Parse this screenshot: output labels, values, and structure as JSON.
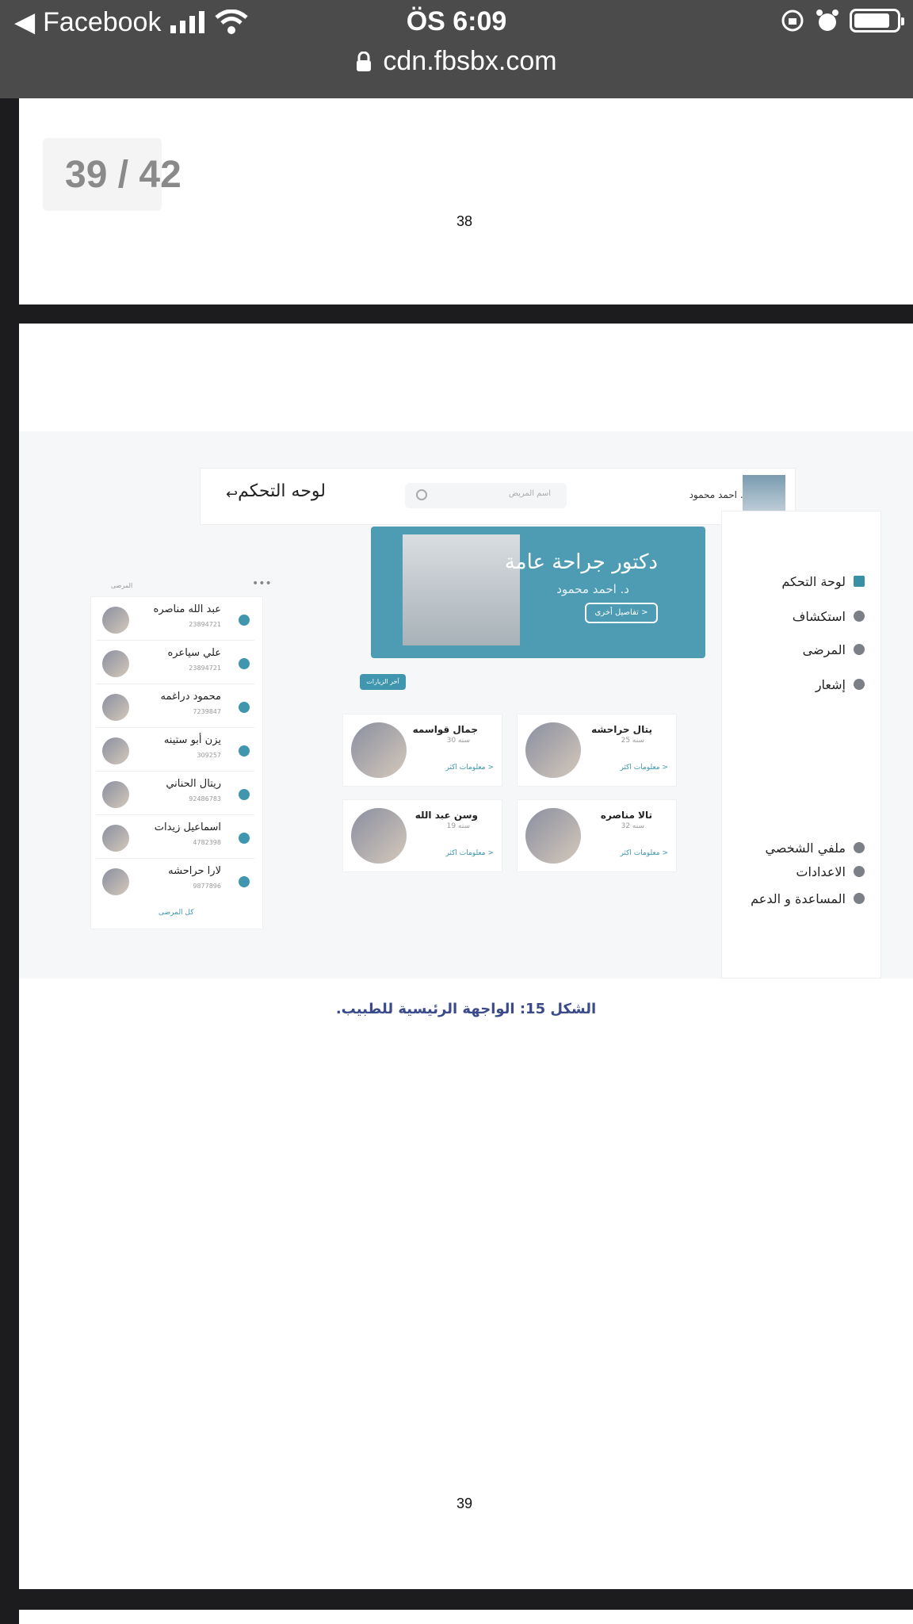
{
  "status_bar": {
    "back_app": "Facebook",
    "time": "ÖS 6:09",
    "url": "cdn.fbsbx.com",
    "battery_level": 0.85
  },
  "viewer": {
    "page_counter": "39 / 42",
    "page1_number": "38",
    "page2_number": "39"
  },
  "figure": {
    "topbar": {
      "title": "لوحه التحكم",
      "search_placeholder": "اسم المريض",
      "user_name": "د. احمد محمود"
    },
    "sidebar": {
      "items": [
        {
          "label": "لوحة التحكم",
          "icon": "grid-icon"
        },
        {
          "label": "استكشاف",
          "icon": "compass-icon"
        },
        {
          "label": "المرضى",
          "icon": "users-icon"
        },
        {
          "label": "إشعار",
          "icon": "bell-icon"
        }
      ],
      "bottom_items": [
        {
          "label": "ملفي الشخصي",
          "icon": "user-icon"
        },
        {
          "label": "الاعدادات",
          "icon": "gear-icon"
        },
        {
          "label": "المساعدة و الدعم",
          "icon": "help-icon"
        }
      ]
    },
    "banner": {
      "title": "دكتور جراحة عامة",
      "subtitle": "د. احمد محمود",
      "button": "< تفاصيل أخرى"
    },
    "visits_button": "آخر الزيارات",
    "patient_cards": [
      {
        "name": "جمال قواسمه",
        "age": "سنه 30",
        "more": "< معلومات اكثر"
      },
      {
        "name": "يتال حراحشه",
        "age": "سنه 25",
        "more": "< معلومات اكثر"
      },
      {
        "name": "وسن عبد الله",
        "age": "سنه 19",
        "more": "< معلومات اكثر"
      },
      {
        "name": "تالا مناصره",
        "age": "سنه 32",
        "more": "< معلومات اكثر"
      }
    ],
    "patient_list": {
      "header": "المرضى",
      "rows": [
        {
          "name": "عبد الله مناصره",
          "id": "23894721"
        },
        {
          "name": "علي سياعره",
          "id": "23894721"
        },
        {
          "name": "محمود دراغمه",
          "id": "7239847"
        },
        {
          "name": "يزن أبو ستينه",
          "id": "309257"
        },
        {
          "name": "ريتال الحناني",
          "id": "92486783"
        },
        {
          "name": "اسماعيل زيدات",
          "id": "4782398"
        },
        {
          "name": "لارا حراحشه",
          "id": "9877896"
        }
      ],
      "all_link": "كل المرضى"
    },
    "caption": "الشكل 15: الواجهة الرئيسية للطبيب."
  }
}
